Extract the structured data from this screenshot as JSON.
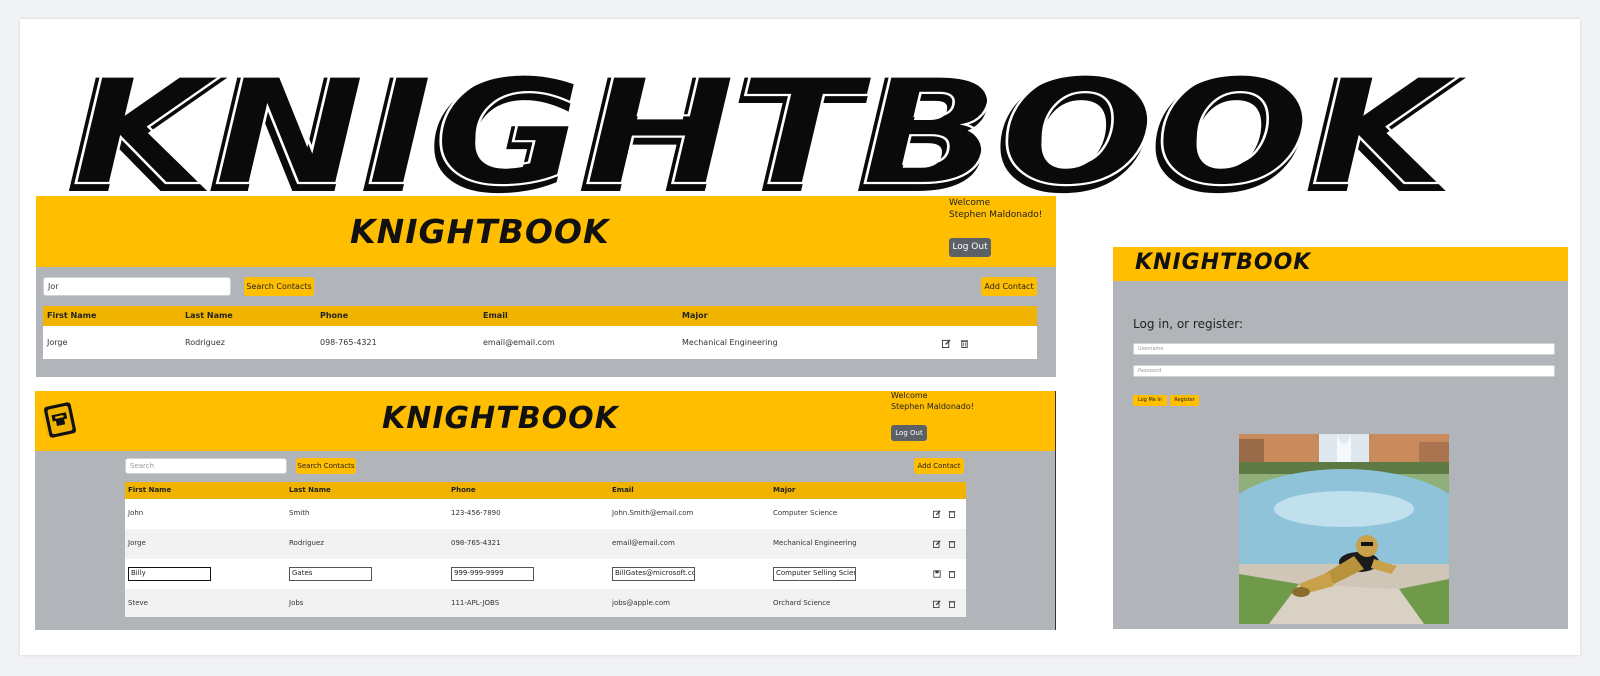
{
  "hero": {
    "logo_text": "KNIGHTBOOK"
  },
  "contacts_search": {
    "brand": "KNIGHTBOOK",
    "welcome_line1": "Welcome",
    "welcome_line2": "Stephen Maldonado!",
    "logout_label": "Log Out",
    "search_value": "Jor",
    "search_button": "Search Contacts",
    "add_button": "Add Contact",
    "columns": [
      "First Name",
      "Last Name",
      "Phone",
      "Email",
      "Major"
    ],
    "rows": [
      {
        "first": "Jorge",
        "last": "Rodriguez",
        "phone": "098-765-4321",
        "email": "email@email.com",
        "major": "Mechanical Engineering"
      }
    ]
  },
  "contacts_list": {
    "brand": "KNIGHTBOOK",
    "welcome_line1": "Welcome",
    "welcome_line2": "Stephen Maldonado!",
    "logout_label": "Log Out",
    "search_placeholder": "Search",
    "search_button": "Search Contacts",
    "add_button": "Add Contact",
    "columns": [
      "First Name",
      "Last Name",
      "Phone",
      "Email",
      "Major"
    ],
    "rows": [
      {
        "first": "John",
        "last": "Smith",
        "phone": "123-456-7890",
        "email": "John.Smith@email.com",
        "major": "Computer Science"
      },
      {
        "first": "Jorge",
        "last": "Rodriguez",
        "phone": "098-765-4321",
        "email": "email@email.com",
        "major": "Mechanical Engineering"
      },
      {
        "first": "Billy",
        "last": "Gates",
        "phone": "999-999-9999",
        "email": "BillGates@microsoft.com",
        "major": "Computer Selling Science"
      },
      {
        "first": "Steve",
        "last": "Jobs",
        "phone": "111-APL-JOBS",
        "email": "jobs@apple.com",
        "major": "Orchard Science"
      }
    ]
  },
  "login": {
    "brand": "KNIGHTBOOK",
    "heading": "Log in, or register:",
    "username_placeholder": "Username",
    "password_placeholder": "Password",
    "login_button": "Log Me In",
    "register_button": "Register"
  },
  "colors": {
    "accent": "#ffbe00",
    "panel": "#b1b4b8",
    "dark_button": "#5b6167"
  },
  "icons": [
    "edit-icon",
    "trash-icon",
    "save-icon",
    "mascot-logo-icon"
  ]
}
